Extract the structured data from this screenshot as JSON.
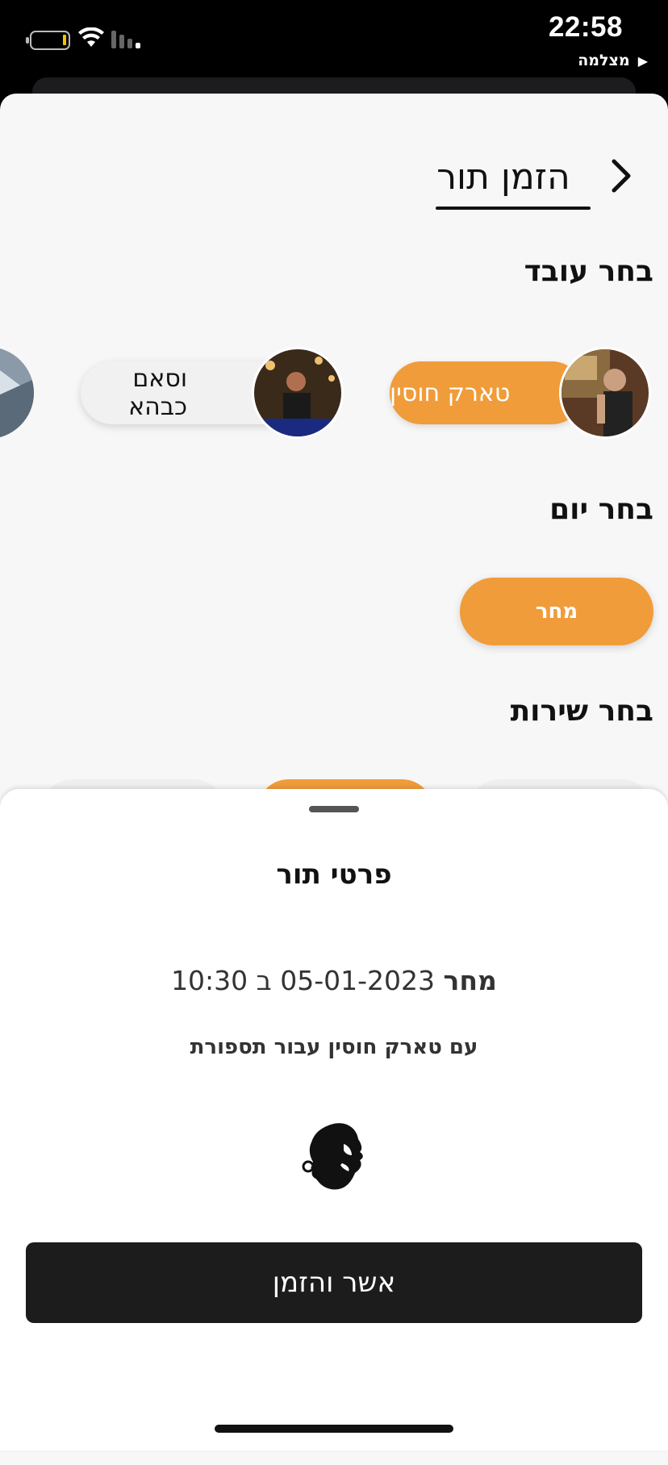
{
  "status_bar": {
    "time": "22:58",
    "back_label": "מצלמה",
    "battery_icon": "battery-low-icon",
    "wifi_icon": "wifi-icon",
    "signal_icon": "cellular-signal-icon"
  },
  "header": {
    "title": "הזמן תור",
    "back_icon": "chevron-right-icon"
  },
  "employee_section": {
    "title": "בחר עובד",
    "employees": [
      {
        "name": "טארק חוסין",
        "selected": true
      },
      {
        "name": "וסאם כבהא",
        "selected": false
      }
    ]
  },
  "day_section": {
    "title": "בחר יום",
    "days": [
      {
        "label": "מחר",
        "selected": true
      }
    ]
  },
  "service_section": {
    "title": "בחר שירות"
  },
  "booking_summary": {
    "title": "פרטי תור",
    "day_word": "מחר",
    "date_time": "05-01-2023 ב 10:30",
    "with_text": "עם טארק חוסין עבור תספורת",
    "logo_icon": "barber-logo-icon",
    "confirm_label": "אשר והזמן"
  },
  "colors": {
    "accent": "#f09c3a",
    "dark_button": "#1c1c1c",
    "background": "#f7f7f7"
  }
}
